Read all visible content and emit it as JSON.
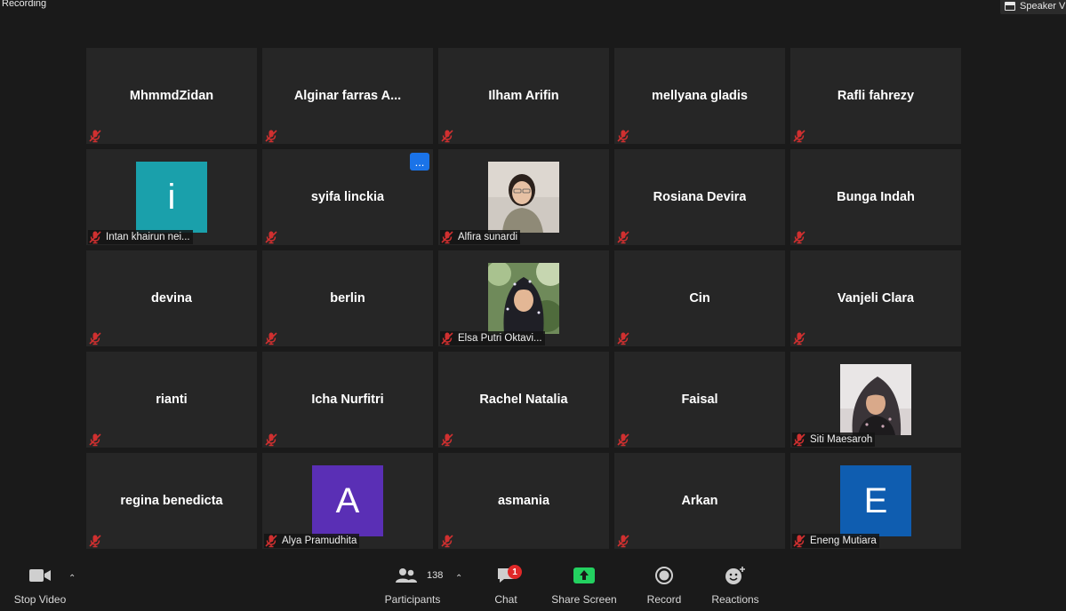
{
  "top_bar": {
    "recording_label": "Recording",
    "speaker_view_label": "Speaker V"
  },
  "colors": {
    "mic_muted": "#d03030",
    "share_green": "#23d160",
    "tile_bg": "#262626",
    "avatar_teal": "#1aa0ab",
    "avatar_purple": "#5a2fb5",
    "avatar_blue": "#0f5db0"
  },
  "participants": [
    {
      "name": "MhmmdZidan",
      "display": "name"
    },
    {
      "name": "Alginar farras A...",
      "display": "name"
    },
    {
      "name": "Ilham Arifin",
      "display": "name"
    },
    {
      "name": "mellyana gladis",
      "display": "name"
    },
    {
      "name": "Rafli fahrezy",
      "display": "name"
    },
    {
      "name": "Intan khairun nei...",
      "display": "avatar",
      "initial": "i",
      "color": "#1aa0ab"
    },
    {
      "name": "syifa linckia",
      "display": "name",
      "more_button": "..."
    },
    {
      "name": "Alfira sunardi",
      "display": "photo",
      "icon": "video-feed-alfira"
    },
    {
      "name": "Rosiana Devira",
      "display": "name"
    },
    {
      "name": "Bunga Indah",
      "display": "name"
    },
    {
      "name": "devina",
      "display": "name"
    },
    {
      "name": "berlin",
      "display": "name"
    },
    {
      "name": "Elsa Putri Oktavi...",
      "display": "photo",
      "icon": "video-feed-elsa"
    },
    {
      "name": "Cin",
      "display": "name"
    },
    {
      "name": "Vanjeli Clara",
      "display": "name"
    },
    {
      "name": "rianti",
      "display": "name"
    },
    {
      "name": "Icha Nurfitri",
      "display": "name"
    },
    {
      "name": "Rachel Natalia",
      "display": "name"
    },
    {
      "name": "Faisal",
      "display": "name"
    },
    {
      "name": "Siti Maesaroh",
      "display": "photo",
      "icon": "video-feed-siti"
    },
    {
      "name": "regina benedicta",
      "display": "name"
    },
    {
      "name": "Alya Pramudhita",
      "display": "avatar",
      "initial": "A",
      "color": "#5a2fb5"
    },
    {
      "name": "asmania",
      "display": "name"
    },
    {
      "name": "Arkan",
      "display": "name"
    },
    {
      "name": "Eneng Mutiara",
      "display": "avatar",
      "initial": "E",
      "color": "#0f5db0"
    }
  ],
  "toolbar": {
    "stop_video": "Stop Video",
    "participants": "Participants",
    "participants_count": "138",
    "chat": "Chat",
    "chat_badge": "1",
    "share_screen": "Share Screen",
    "record": "Record",
    "reactions": "Reactions"
  }
}
